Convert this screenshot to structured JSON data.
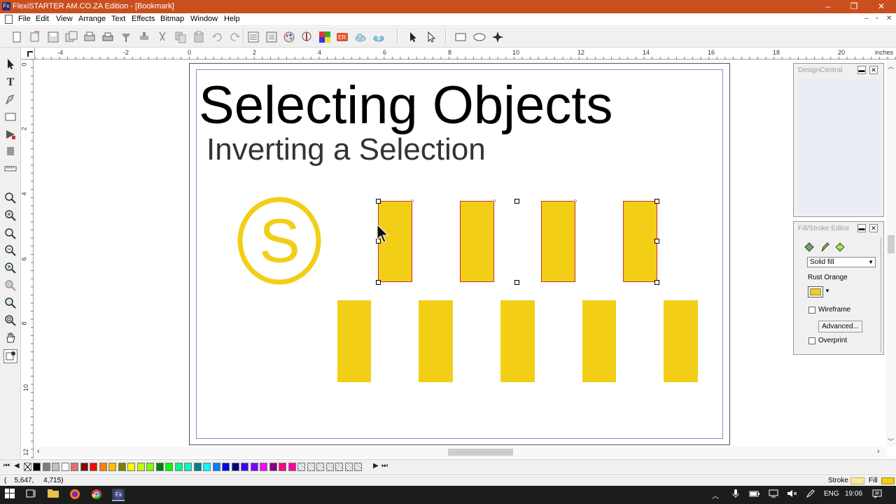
{
  "window": {
    "title": "FlexiSTARTER AM.CO.ZA Edition - [Bookmark]",
    "controls": {
      "minimize": "–",
      "maximize": "❐",
      "close": "✕"
    },
    "mdi_controls": {
      "minimize": "–",
      "restore": "▫",
      "close": "✕"
    }
  },
  "menu": {
    "items": [
      "File",
      "Edit",
      "View",
      "Arrange",
      "Text",
      "Effects",
      "Bitmap",
      "Window",
      "Help"
    ]
  },
  "ruler": {
    "h_labels": [
      "-4",
      "-2",
      "0",
      "2",
      "4",
      "6",
      "8",
      "10",
      "12",
      "14",
      "16",
      "18",
      "20"
    ],
    "unit": "inches",
    "v_labels": [
      "0",
      "2",
      "4",
      "6",
      "8",
      "10",
      "12"
    ]
  },
  "document": {
    "heading": "Selecting Objects",
    "subheading": "Inverting a Selection",
    "logo_letter": "S",
    "shape_color": "#f2cf16"
  },
  "design_central": {
    "title": "DesignCentral"
  },
  "fill_stroke_editor": {
    "title": "Fill/Stroke Editor",
    "fill_type": "Solid fill",
    "color_name": "Rust Orange",
    "swatch_color": "#f2cf16",
    "wireframe_label": "Wireframe",
    "advanced_label": "Advanced...",
    "overprint_label": "Overprint"
  },
  "palette": {
    "colors": [
      "#000000",
      "#7f7f7f",
      "#c0c0c0",
      "#ffffff",
      "#e07070",
      "#800000",
      "#ff0000",
      "#ff8000",
      "#ffbf00",
      "#808000",
      "#ffff00",
      "#c0ff00",
      "#80ff00",
      "#008000",
      "#00ff00",
      "#00ff80",
      "#00ffc0",
      "#008080",
      "#00ffff",
      "#0080ff",
      "#0000ff",
      "#000080",
      "#4000ff",
      "#8000ff",
      "#ff00ff",
      "#800080",
      "#ff0080",
      "#ff00a0"
    ]
  },
  "status": {
    "coordinates": "(    5,647,     4,715)",
    "stroke_label": "Stroke",
    "fill_label": "Fill",
    "stroke_color": "#f7e9a0",
    "fill_color": "#f2cf16"
  },
  "taskbar": {
    "language": "ENG",
    "time": "19:06"
  }
}
